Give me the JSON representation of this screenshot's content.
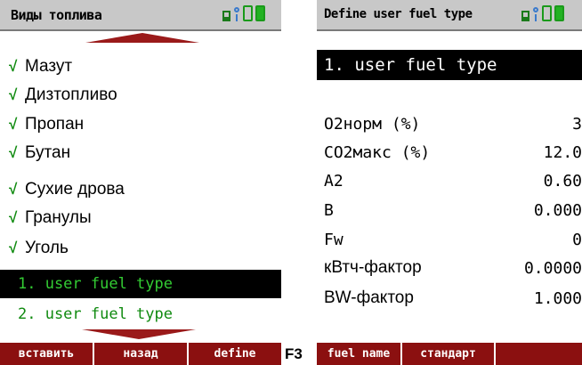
{
  "left": {
    "title": "Виды топлива",
    "items": [
      {
        "check": "√",
        "label": "Мазут"
      },
      {
        "check": "√",
        "label": "Дизтопливо"
      },
      {
        "check": "√",
        "label": "Пропан"
      },
      {
        "check": "√",
        "label": "Бутан"
      },
      {
        "check": "√",
        "label": "Сухие дрова"
      },
      {
        "check": "√",
        "label": "Гранулы"
      },
      {
        "check": "√",
        "label": "Уголь"
      }
    ],
    "user_items": [
      {
        "label": "1. user fuel type",
        "selected": true
      },
      {
        "label": "2. user fuel type",
        "selected": false
      }
    ],
    "menu": [
      "вставить",
      "назад",
      "define"
    ]
  },
  "f3_label": "F3",
  "right": {
    "title": "Define user fuel type",
    "selected_name": "1. user fuel type",
    "params": [
      {
        "label": "O2норм (%)",
        "value": "3"
      },
      {
        "label": "CO2макс (%)",
        "value": "12.0"
      },
      {
        "label": "A2",
        "value": "0.60"
      },
      {
        "label": "B",
        "value": "0.000"
      },
      {
        "label": "Fw",
        "value": "0"
      },
      {
        "label": "кВтч-фактор",
        "value": "0.0000"
      },
      {
        "label": "BW-фактор",
        "value": "1.000"
      }
    ],
    "menu": [
      "fuel name",
      "стандарт",
      ""
    ]
  },
  "colors": {
    "menu_bg": "#8b1010",
    "arrow": "#9a1a1a",
    "check": "#0f8a0f",
    "selected_bg": "#000000",
    "titlebar": "#c8c8c8"
  },
  "icons": [
    "status-icon",
    "signal-icon",
    "battery-icon",
    "battery-icon"
  ]
}
